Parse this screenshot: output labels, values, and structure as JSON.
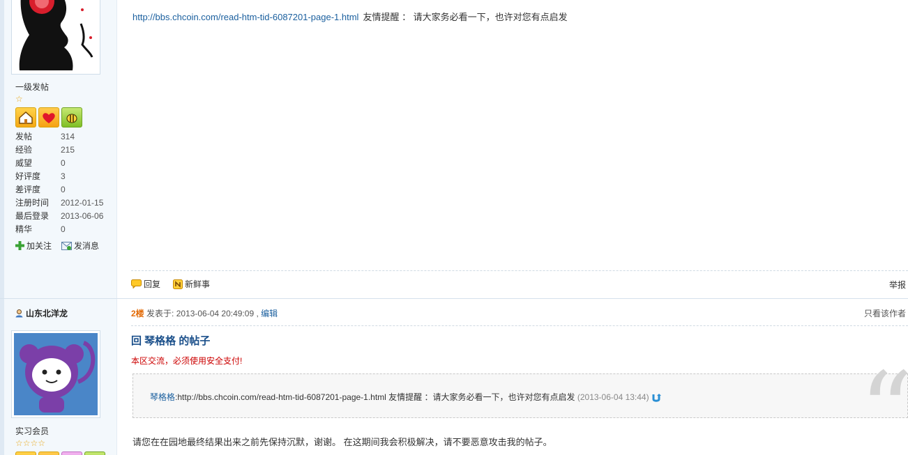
{
  "post1": {
    "user": {
      "level": "一级发帖",
      "stars": "☆",
      "stats": [
        {
          "key": "发帖",
          "value": "314"
        },
        {
          "key": "经验",
          "value": "215"
        },
        {
          "key": "威望",
          "value": "0"
        },
        {
          "key": "好评度",
          "value": "3"
        },
        {
          "key": "差评度",
          "value": "0"
        },
        {
          "key": "注册时间",
          "value": "2012-01-15"
        },
        {
          "key": "最后登录",
          "value": "2013-06-06"
        },
        {
          "key": "精华",
          "value": "0"
        }
      ],
      "follow_label": "加关注",
      "message_label": "发消息"
    },
    "link": "http://bbs.chcoin.com/read-htm-tid-6087201-page-1.html",
    "note": "友情提醒 ： 请大家务必看一下，也许对您有点启发",
    "reply_label": "回复",
    "fresh_label": "新鲜事",
    "report_label": "举报"
  },
  "post2": {
    "user": {
      "name": "山东北洋龙",
      "level": "实习会员",
      "stars": "☆☆☆☆"
    },
    "floor": "2楼",
    "posted": " 发表于: 2013-06-04 20:49:09 , ",
    "edit_label": "编辑",
    "only_author_label": "只看该作者",
    "title": "回 琴格格 的帖子",
    "warning": "本区交流，必须使用安全支付!",
    "quote": {
      "author": "琴格格",
      "text": ":http://bbs.chcoin.com/read-htm-tid-6087201-page-1.html  友情提醒 ：请大家务必看一下，也许对您有点启发 ",
      "time": "(2013-06-04 13:44)"
    },
    "body": "请您在在园地最终结果出来之前先保持沉默，谢谢。 在这期间我会积极解决，请不要恶意攻击我的帖子。"
  },
  "colors": {
    "link": "#1a5f9e",
    "title": "#1a4f8a",
    "warning": "#cc0000",
    "floor": "#e36c09"
  }
}
